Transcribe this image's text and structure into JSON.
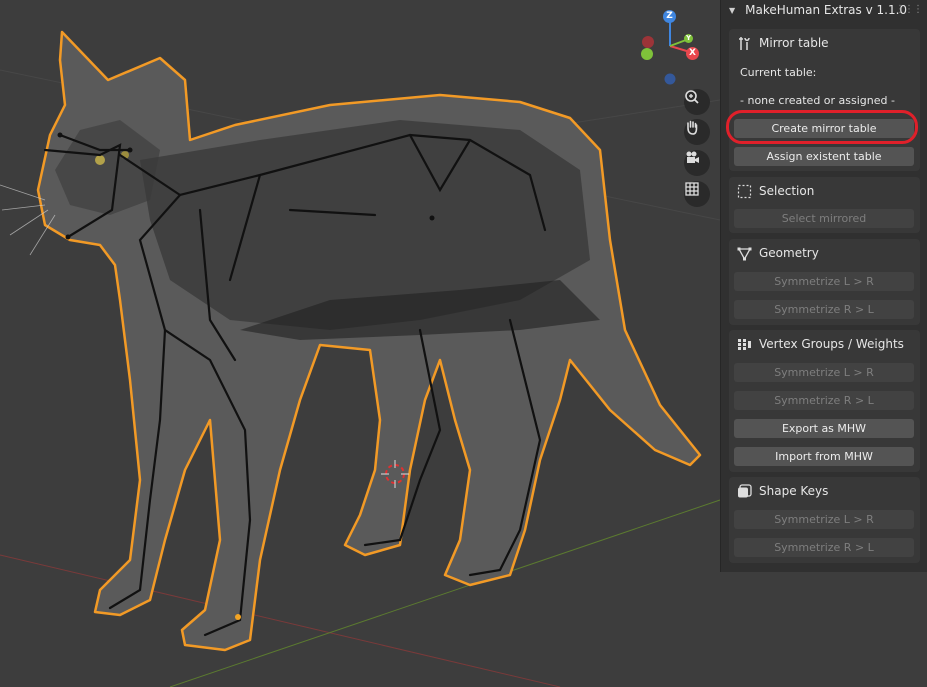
{
  "panel": {
    "title": "MakeHuman Extras v 1.1.0",
    "grip_icon": "drag-grip-icon"
  },
  "mirror_table": {
    "title": "Mirror table",
    "icon": "wrench-screwdriver-icon",
    "current_label": "Current table:",
    "current_value": "- none created or assigned -",
    "create_label": "Create mirror table",
    "assign_label": "Assign existent table"
  },
  "selection": {
    "title": "Selection",
    "icon": "dotted-box-icon",
    "select_mirrored_label": "Select mirrored"
  },
  "geometry": {
    "title": "Geometry",
    "icon": "geometry-vertex-icon",
    "sym_lr_label": "Symmetrize L > R",
    "sym_rl_label": "Symmetrize R > L"
  },
  "vertex_groups": {
    "title": "Vertex Groups / Weights",
    "icon": "vertex-groups-icon",
    "sym_lr_label": "Symmetrize L > R",
    "sym_rl_label": "Symmetrize R > L",
    "export_label": "Export as MHW",
    "import_label": "Import from MHW"
  },
  "shape_keys": {
    "title": "Shape Keys",
    "icon": "shape-keys-icon",
    "sym_lr_label": "Symmetrize L > R",
    "sym_rl_label": "Symmetrize R > L"
  },
  "gizmo": {
    "z_label": "Z",
    "x_label": "X",
    "y_label": "Y",
    "colors": {
      "x": "#e8474e",
      "y": "#7fc23a",
      "z": "#3f86e0",
      "neg_x": "#9c3438",
      "neg_z": "#34589a"
    }
  },
  "nav_tools": [
    "zoom-icon",
    "hand-pan-icon",
    "camera-icon",
    "grid-icon"
  ],
  "highlight_color": "#e0202a"
}
